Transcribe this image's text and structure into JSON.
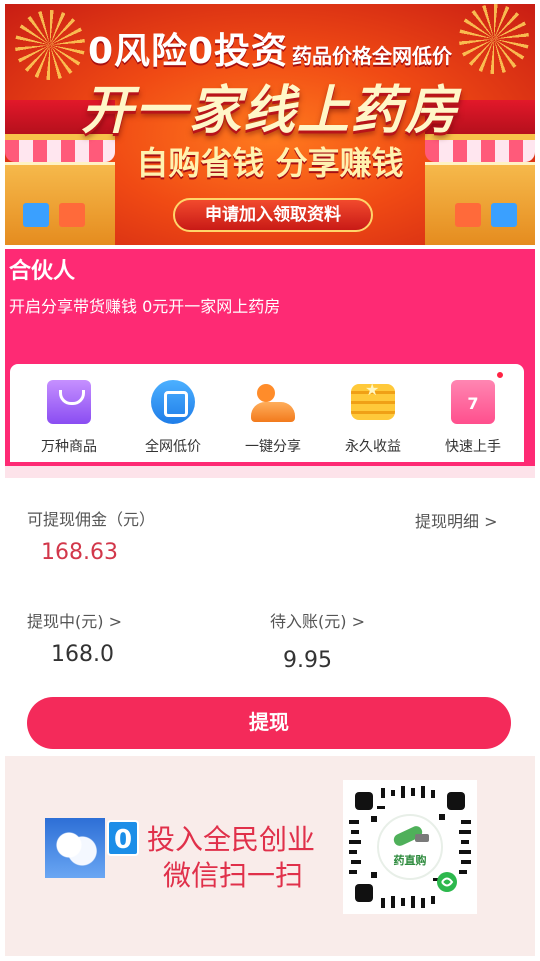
{
  "banner": {
    "title_big": "0风险0投资",
    "title_small": "药品价格全网低价",
    "headline": "开一家线上药房",
    "slogan": "自购省钱 分享赚钱",
    "cta": "申请加入领取资料"
  },
  "partner": {
    "title": "合伙人",
    "subtitle": "开启分享带货赚钱 0元开一家网上药房"
  },
  "features": [
    {
      "label": "万种商品",
      "icon": "shopping-bag-icon"
    },
    {
      "label": "全网低价",
      "icon": "price-tag-icon"
    },
    {
      "label": "一键分享",
      "icon": "share-people-icon"
    },
    {
      "label": "永久收益",
      "icon": "coin-stack-icon"
    },
    {
      "label": "快速上手",
      "icon": "calendar-icon"
    }
  ],
  "commission": {
    "withdrawable_label": "可提现佣金（元）",
    "withdrawable_value": "168.63",
    "detail_link": "提现明细 >",
    "pending_label": "提现中(元) >",
    "pending_value": "168.0",
    "to_arrive_label": "待入账(元) >",
    "to_arrive_value": "9.95",
    "withdraw_button": "提现"
  },
  "promo": {
    "zero": "0",
    "line1": "投入全民创业",
    "line2": "微信扫一扫",
    "qr_brand": "药直购"
  },
  "colors": {
    "brand_pink": "#fe2a74",
    "button_red": "#f42a5a",
    "amount_red": "#d2374a",
    "banner_red": "#e33318"
  }
}
